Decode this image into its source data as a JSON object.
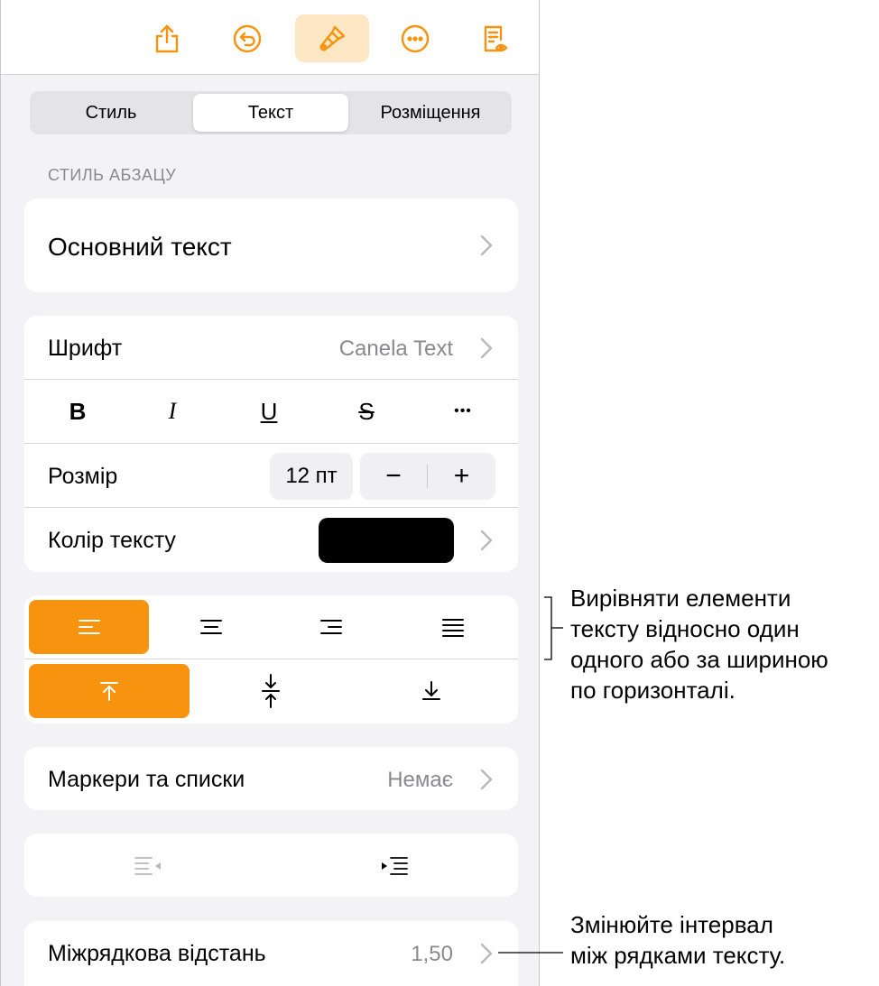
{
  "toolbar": {
    "icons": [
      "share-icon",
      "undo-icon",
      "paintbrush-icon",
      "more-icon",
      "reader-view-icon"
    ],
    "accent": "#f7930e"
  },
  "tabs": [
    {
      "label": "Стиль"
    },
    {
      "label": "Текст",
      "selected": true
    },
    {
      "label": "Розміщення"
    }
  ],
  "paragraph_style": {
    "section_label": "СТИЛЬ АБЗАЦУ",
    "value": "Основний текст"
  },
  "font": {
    "label": "Шрифт",
    "value": "Canela Text",
    "bold": "B",
    "italic": "I",
    "underline": "U",
    "strike": "S",
    "more": "•••"
  },
  "size": {
    "label": "Розмір",
    "value": "12 пт",
    "minus": "−",
    "plus": "+"
  },
  "text_color": {
    "label": "Колір тексту",
    "swatch": "#000000"
  },
  "alignment": {
    "horizontal": [
      "align-left",
      "align-center",
      "align-right",
      "justify"
    ],
    "horizontal_selected": "align-left",
    "vertical": [
      "align-top",
      "align-middle",
      "align-bottom"
    ],
    "vertical_selected": "align-top"
  },
  "bullets": {
    "label": "Маркери та списки",
    "value": "Немає"
  },
  "indent": {
    "icons": [
      "decrease-indent-icon",
      "increase-indent-icon"
    ]
  },
  "line_spacing": {
    "label": "Міжрядкова відстань",
    "value": "1,50"
  },
  "callouts": {
    "alignment": [
      "Вирівняти елементи",
      "тексту відносно один",
      "одного або за шириною",
      "по горизонталі."
    ],
    "spacing": [
      "Змінюйте інтервал",
      "між рядками тексту."
    ]
  }
}
